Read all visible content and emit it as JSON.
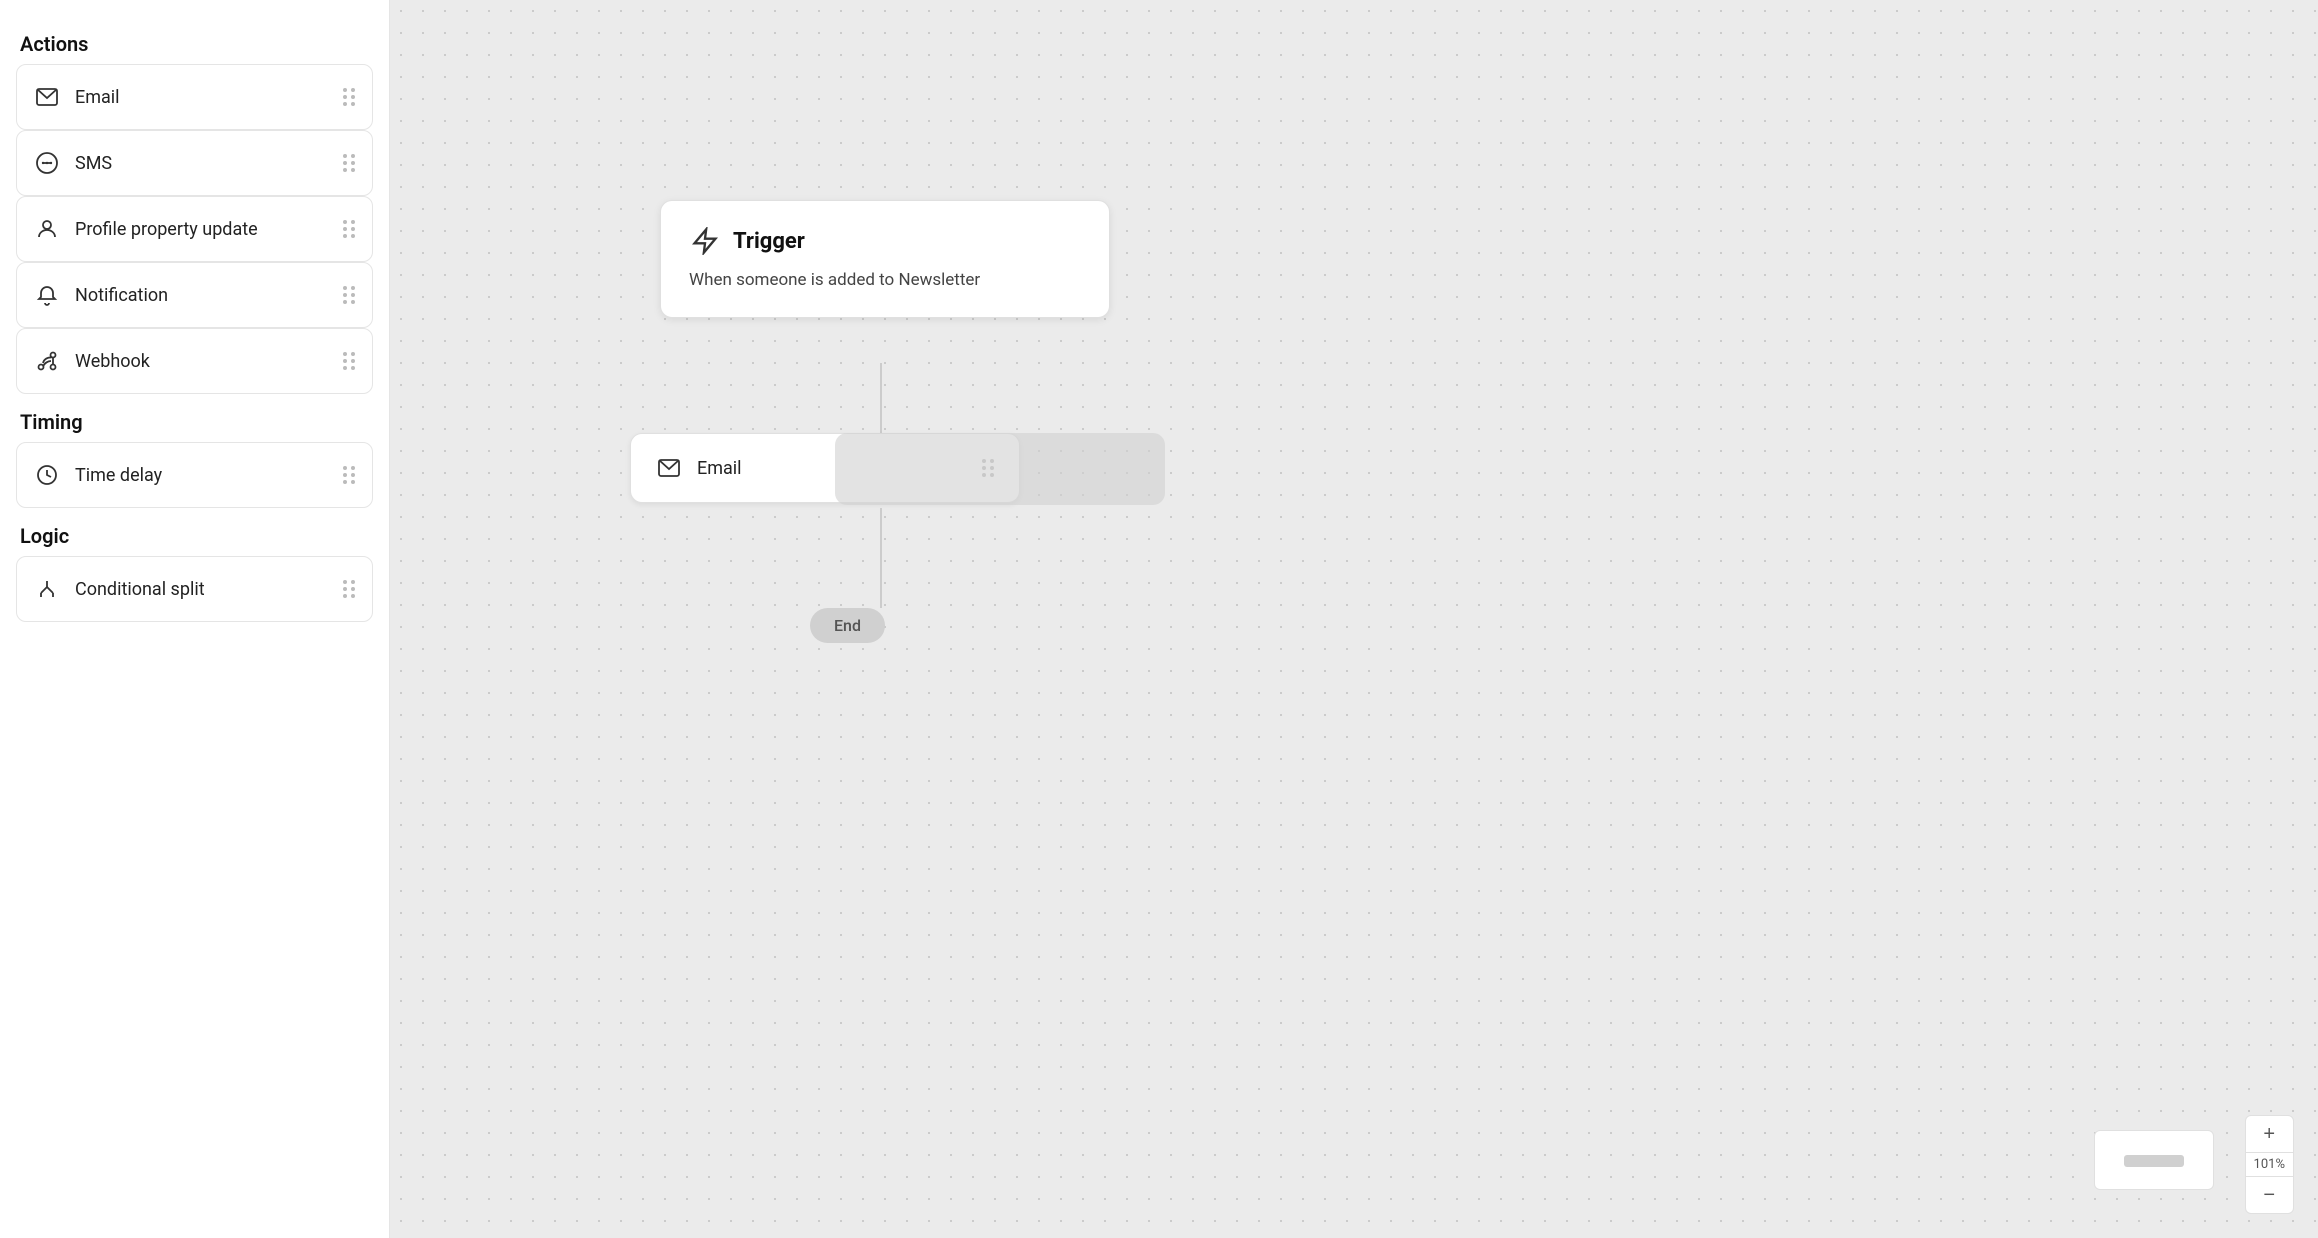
{
  "sidebar": {
    "sections": [
      {
        "title": "Actions",
        "items": [
          {
            "id": "email",
            "label": "Email",
            "icon": "email-icon"
          },
          {
            "id": "sms",
            "label": "SMS",
            "icon": "sms-icon"
          },
          {
            "id": "profile-property-update",
            "label": "Profile property update",
            "icon": "profile-icon"
          },
          {
            "id": "notification",
            "label": "Notification",
            "icon": "notification-icon"
          },
          {
            "id": "webhook",
            "label": "Webhook",
            "icon": "webhook-icon"
          }
        ]
      },
      {
        "title": "Timing",
        "items": [
          {
            "id": "time-delay",
            "label": "Time delay",
            "icon": "clock-icon"
          }
        ]
      },
      {
        "title": "Logic",
        "items": [
          {
            "id": "conditional-split",
            "label": "Conditional split",
            "icon": "split-icon"
          }
        ]
      }
    ]
  },
  "canvas": {
    "trigger": {
      "title": "Trigger",
      "description": "When someone is added to Newsletter"
    },
    "email_node": {
      "label": "Email"
    },
    "end_node": {
      "label": "End"
    }
  },
  "zoom": {
    "level": "101%",
    "plus_label": "+",
    "minus_label": "−"
  }
}
